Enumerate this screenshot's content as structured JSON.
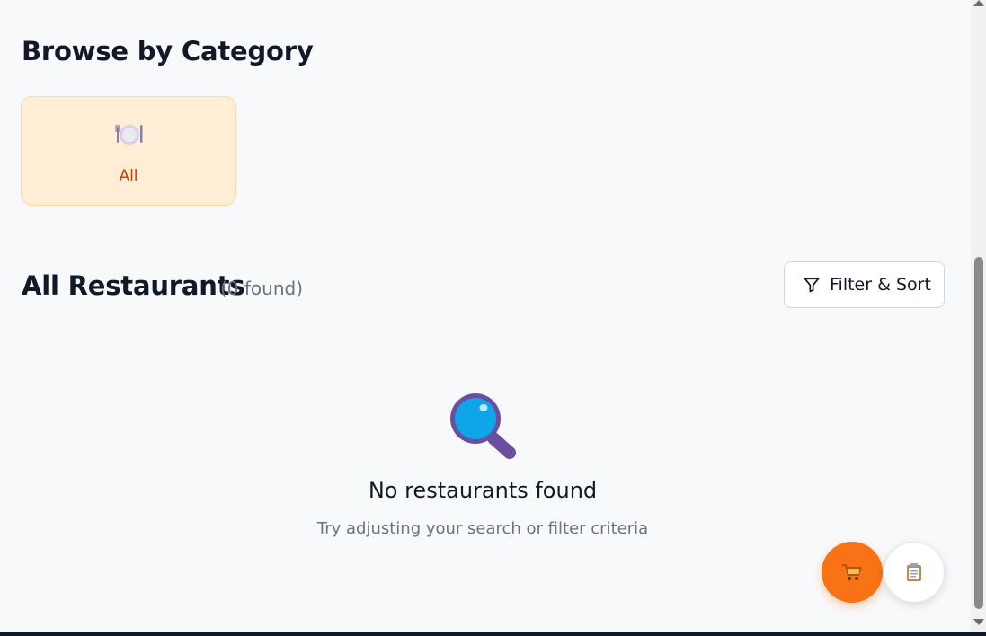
{
  "categories_section": {
    "title": "Browse by Category",
    "items": [
      {
        "icon": "plate-with-cutlery-icon",
        "label": "All",
        "selected": true
      }
    ]
  },
  "restaurants_section": {
    "title": "All Restaurants",
    "count_text": "(0 found)",
    "filter_button_label": "Filter & Sort"
  },
  "empty_state": {
    "icon": "magnifying-glass-icon",
    "title": "No restaurants found",
    "subtitle": "Try adjusting your search or filter criteria"
  },
  "floating_buttons": {
    "cart_icon": "cart-icon",
    "orders_icon": "clipboard-icon"
  },
  "colors": {
    "accent": "#f97316",
    "category_selected_bg": "#ffedd5",
    "category_selected_text": "#c2410c",
    "empty_icon_lens": "#0ea5e9",
    "empty_icon_frame": "#6b4f9e"
  }
}
